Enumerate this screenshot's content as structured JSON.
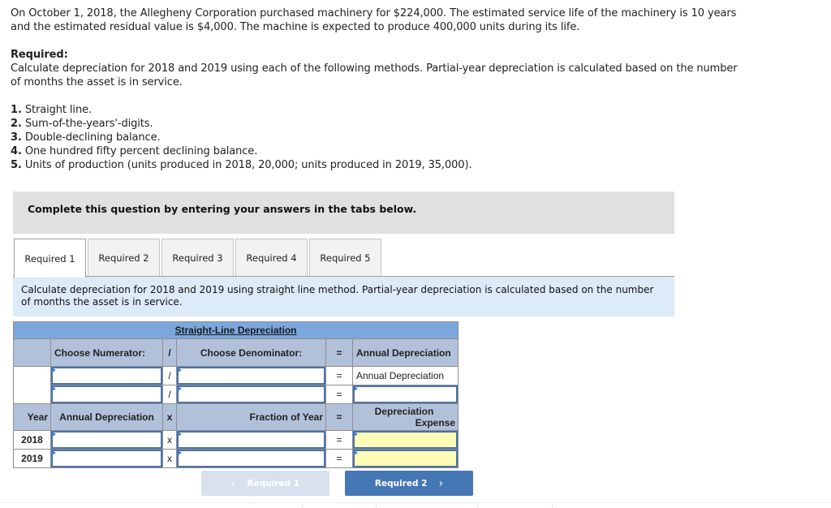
{
  "problem": {
    "intro": "On October 1, 2018, the Allegheny Corporation purchased machinery for $224,000. The estimated service life of the machinery is 10 years and the estimated residual value is $4,000. The machine is expected to produce 400,000 units during its life.",
    "required_label": "Required:",
    "required_text": "Calculate depreciation for 2018 and 2019 using each of the following methods. Partial-year depreciation is calculated based on the number of months the asset is in service.",
    "methods": [
      {
        "num": "1.",
        "text": " Straight line."
      },
      {
        "num": "2.",
        "text": " Sum-of-the-years'-digits."
      },
      {
        "num": "3.",
        "text": " Double-declining balance."
      },
      {
        "num": "4.",
        "text": " One hundred fifty percent declining balance."
      },
      {
        "num": "5.",
        "text": " Units of production (units produced in 2018, 20,000; units produced in 2019, 35,000)."
      }
    ]
  },
  "banner": "Complete this question by entering your answers in the tabs below.",
  "tabs": [
    {
      "label": "Required 1",
      "active": true
    },
    {
      "label": "Required 2",
      "active": false
    },
    {
      "label": "Required 3",
      "active": false
    },
    {
      "label": "Required 4",
      "active": false
    },
    {
      "label": "Required 5",
      "active": false
    }
  ],
  "instruction": "Calculate depreciation for 2018 and 2019 using straight line method. Partial-year depreciation is calculated based on the number of months the asset is in service.",
  "table": {
    "title": "Straight-Line Depreciation",
    "header1": {
      "numerator": "Choose Numerator:",
      "div": "/",
      "denominator": "Choose Denominator:",
      "eq": "=",
      "result": "Annual Depreciation"
    },
    "calc_rows": [
      {
        "numerator": "",
        "div": "/",
        "denominator": "",
        "eq": "=",
        "result_text": "Annual Depreciation"
      },
      {
        "numerator": "",
        "div": "/",
        "denominator": "",
        "eq": "=",
        "result": ""
      }
    ],
    "header2": {
      "year": "Year",
      "annual": "Annual Depreciation",
      "times": "x",
      "fraction": "Fraction of Year",
      "eq": "=",
      "expense_line1": "Depreciation",
      "expense_line2": "Expense"
    },
    "year_rows": [
      {
        "year": "2018",
        "annual": "",
        "times": "x",
        "fraction": "",
        "eq": "=",
        "expense": ""
      },
      {
        "year": "2019",
        "annual": "",
        "times": "x",
        "fraction": "",
        "eq": "=",
        "expense": ""
      }
    ]
  },
  "nav": {
    "prev_label": "Required 1",
    "next_label": "Required 2",
    "prev_icon": "‹",
    "next_icon": "›"
  },
  "colors": {
    "title_bar": "#7ba7dc",
    "header_bg": "#b2c1da",
    "input_border": "#4b73a8",
    "answer_yellow": "#fefcb6",
    "next_button": "#4677b5",
    "prev_button_disabled": "#d8e2ee",
    "instruction_bg": "#ddeaf7",
    "banner_bg": "#e0e0e0"
  }
}
